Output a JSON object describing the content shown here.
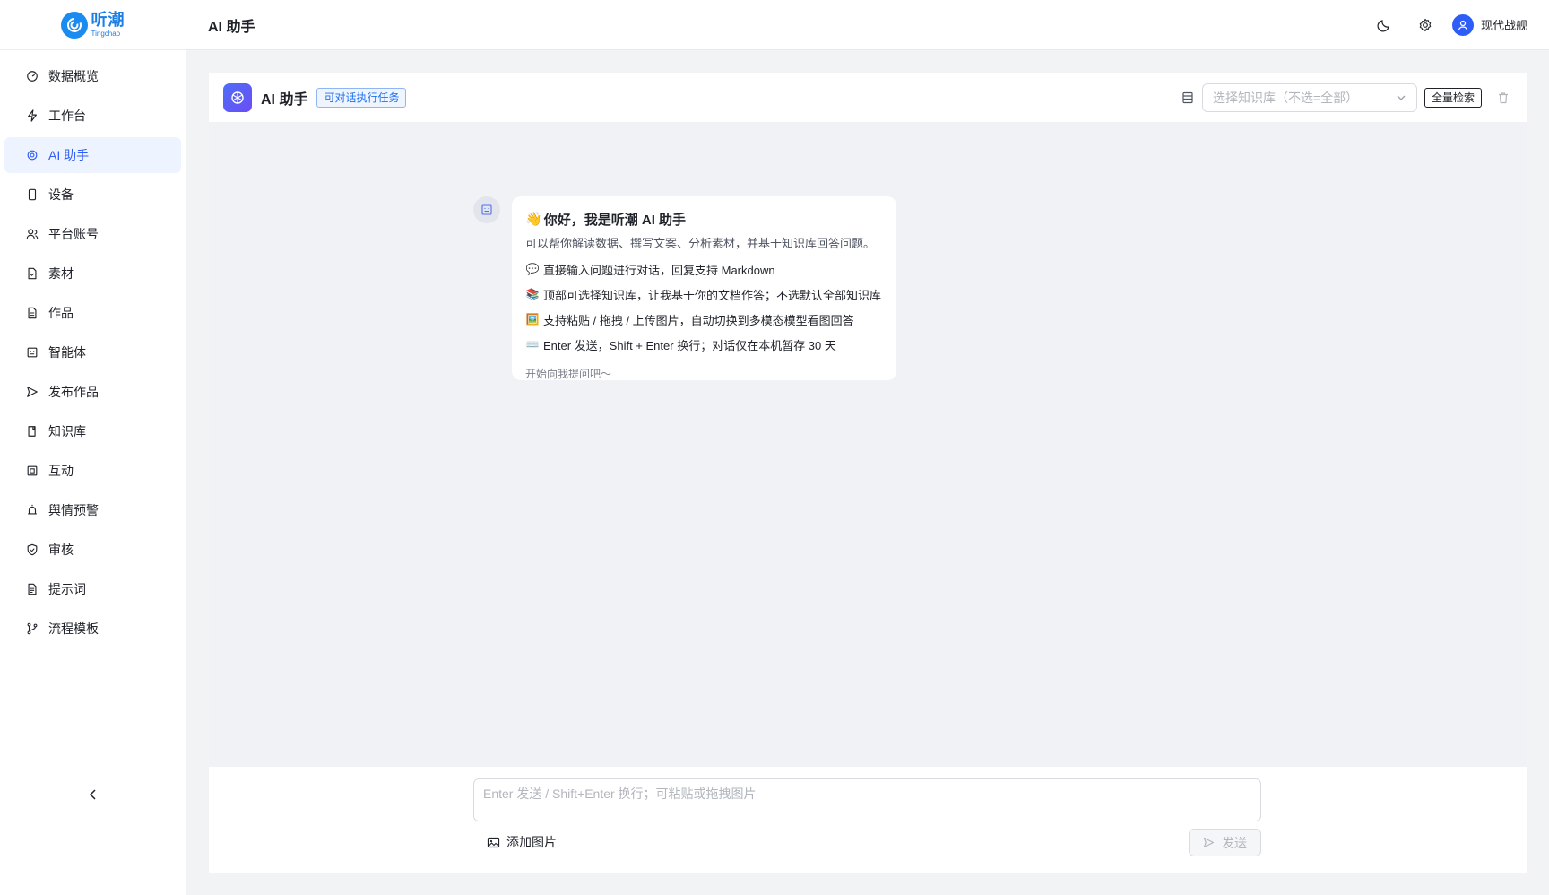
{
  "brand": {
    "name_cn": "听潮",
    "name_en": "Tingchao"
  },
  "sidebar": {
    "items": [
      {
        "label": "数据概览",
        "icon": "dashboard-icon"
      },
      {
        "label": "工作台",
        "icon": "lightning-icon"
      },
      {
        "label": "AI 助手",
        "icon": "ai-icon",
        "active": true
      },
      {
        "label": "设备",
        "icon": "device-icon"
      },
      {
        "label": "平台账号",
        "icon": "users-icon"
      },
      {
        "label": "素材",
        "icon": "file-icon"
      },
      {
        "label": "作品",
        "icon": "document-icon"
      },
      {
        "label": "智能体",
        "icon": "bot-icon"
      },
      {
        "label": "发布作品",
        "icon": "send-icon"
      },
      {
        "label": "知识库",
        "icon": "book-icon"
      },
      {
        "label": "互动",
        "icon": "interaction-icon"
      },
      {
        "label": "舆情预警",
        "icon": "alarm-icon"
      },
      {
        "label": "审核",
        "icon": "shield-check-icon"
      },
      {
        "label": "提示词",
        "icon": "prompt-icon"
      },
      {
        "label": "流程模板",
        "icon": "branch-icon"
      }
    ]
  },
  "topbar": {
    "title": "AI 助手",
    "user_name": "现代战舰"
  },
  "panel": {
    "title": "AI 助手",
    "badge": "可对话执行任务",
    "kb_placeholder": "选择知识库（不选=全部）",
    "full_search": "全量检索"
  },
  "welcome": {
    "wave": "👋",
    "title": "你好，我是听潮 AI 助手",
    "subtitle": "可以帮你解读数据、撰写文案、分析素材，并基于知识库回答问题。",
    "tips": [
      {
        "emoji": "💬",
        "text": "直接输入问题进行对话，回复支持 Markdown"
      },
      {
        "emoji": "📚",
        "text": "顶部可选择知识库，让我基于你的文档作答；不选默认全部知识库"
      },
      {
        "emoji": "🖼️",
        "text": "支持粘贴 / 拖拽 / 上传图片，自动切换到多模态模型看图回答"
      },
      {
        "emoji": "⌨️",
        "text": "Enter 发送，Shift + Enter 换行；对话仅在本机暂存 30 天"
      }
    ],
    "ask": "开始向我提问吧～"
  },
  "composer": {
    "placeholder": "Enter 发送 / Shift+Enter 换行；可粘贴或拖拽图片",
    "add_image": "添加图片",
    "send": "发送"
  },
  "colors": {
    "accent": "#2d5cf6",
    "brand": "#1a7ee6",
    "active_bg": "#eef4ff"
  }
}
